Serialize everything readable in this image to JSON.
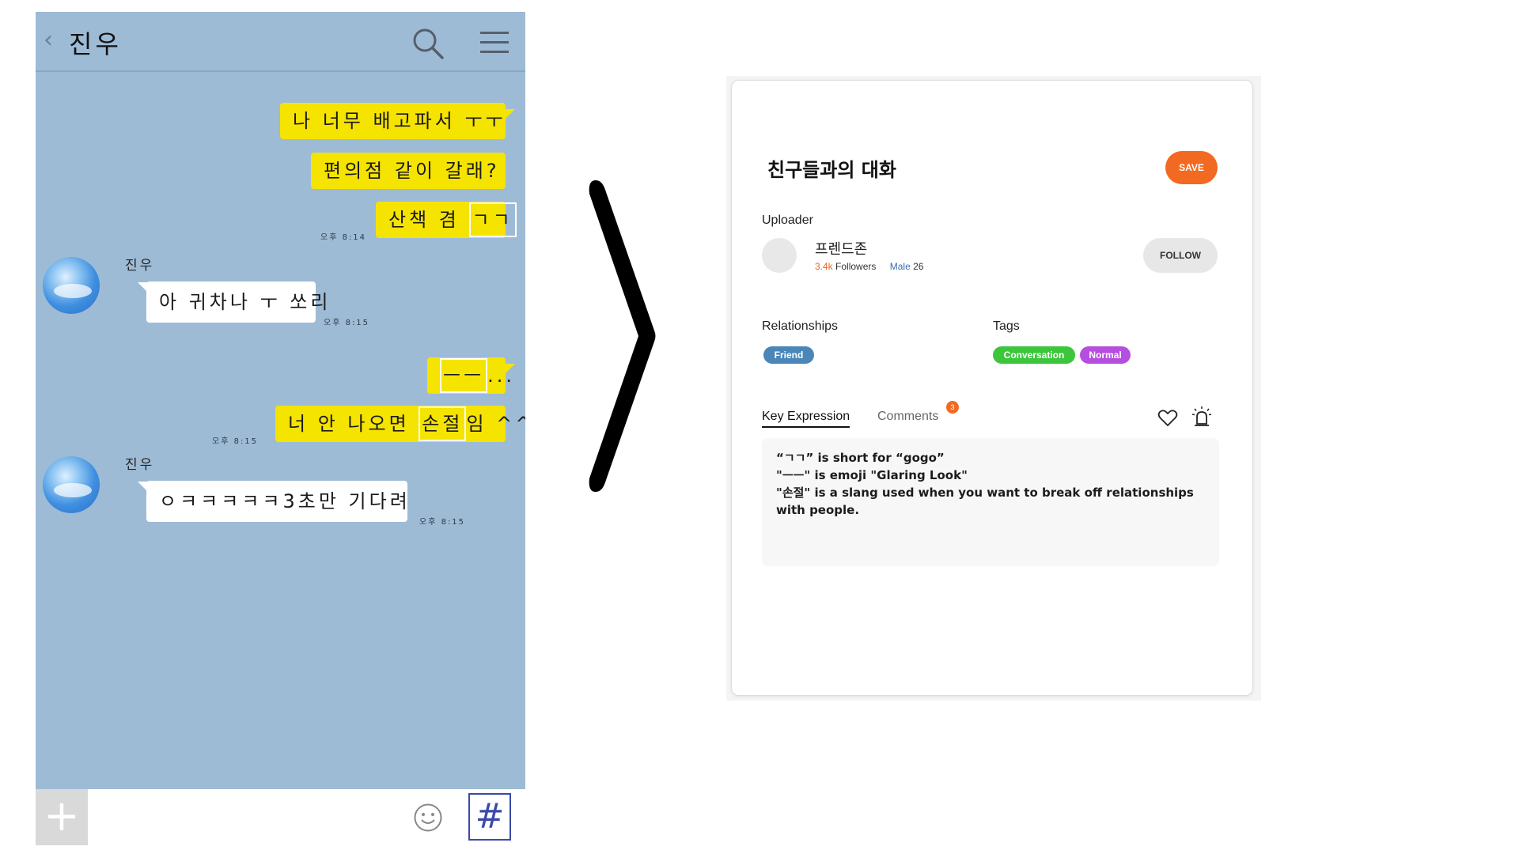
{
  "chat": {
    "title": "진우",
    "back_icon": "chevron-left-icon",
    "search_icon": "search-icon",
    "menu_icon": "menu-icon",
    "messages": [
      {
        "side": "right",
        "text": "나 너무 배고파서 ㅜㅜ"
      },
      {
        "side": "right",
        "text": "편의점 같이 갈래?"
      },
      {
        "side": "right",
        "text_pre": "산책 겸 ",
        "text_hl": "ㄱㄱ",
        "time": "오후 8:14"
      },
      {
        "side": "left",
        "sender": "진우",
        "text": "아 귀차나 ㅜ 쏘리",
        "time": "오후 8:15"
      },
      {
        "side": "right",
        "text_hl": "ㅡㅡ",
        "text_post": "..."
      },
      {
        "side": "right",
        "text_pre": "너 안 나오면 ",
        "text_hl": "손절",
        "text_post": "임 ^^",
        "time": "오후 8:15"
      },
      {
        "side": "left",
        "sender": "진우",
        "text": "ㅇㅋㅋㅋㅋㅋ3초만 기다려",
        "time": "오후 8:15"
      }
    ],
    "footer": {
      "plus_label": "+",
      "hash_label": "#",
      "emoji_icon": "smiley-icon"
    },
    "colors": {
      "background": "#9ebbd6",
      "my_bubble": "#f5e300",
      "their_bubble": "#ffffff"
    }
  },
  "arrow_icon": "chevron-right-icon",
  "card": {
    "title": "친구들과의 대화",
    "save_label": "SAVE",
    "uploader_label": "Uploader",
    "uploader": {
      "name": "프렌드존",
      "followers_count": "3.4k",
      "followers_label": "Followers",
      "gender": "Male",
      "age": "26"
    },
    "follow_label": "FOLLOW",
    "relationships_label": "Relationships",
    "relationships": [
      "Friend"
    ],
    "tags_label": "Tags",
    "tags": [
      "Conversation",
      "Normal"
    ],
    "tabs": {
      "key_expression": "Key Expression",
      "comments": "Comments",
      "comments_count": "3"
    },
    "icons": {
      "like": "heart-icon",
      "report": "alarm-icon"
    },
    "key_expressions": [
      "“ㄱㄱ” is short for “gogo”",
      "\"ㅡㅡ\" is emoji \"Glaring Look\"",
      "\"손절\" is a slang used when you want to break off relationships with people."
    ],
    "colors": {
      "save": "#f26a21",
      "friend_tag": "#4a86b8",
      "conversation_tag": "#3cc63c",
      "normal_tag": "#b64ee0"
    }
  }
}
